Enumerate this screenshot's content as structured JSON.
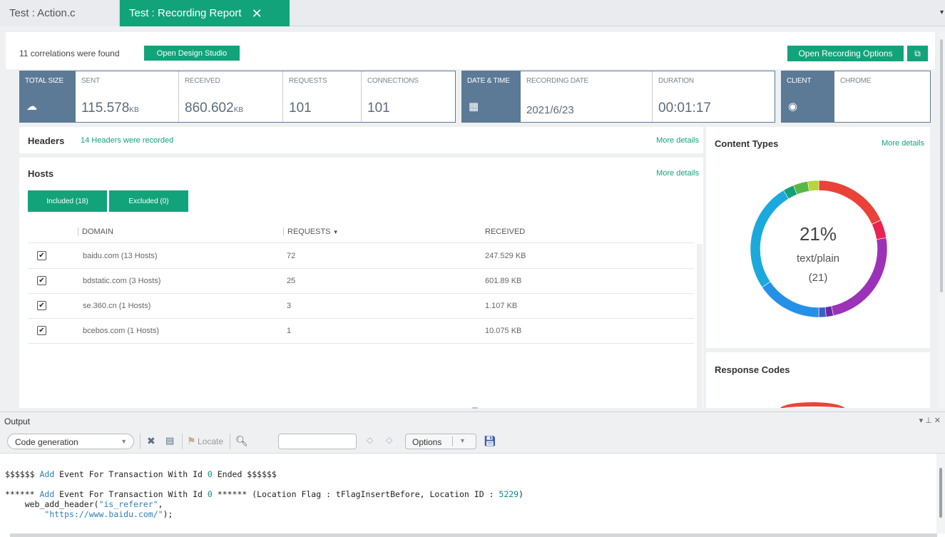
{
  "tabs": [
    {
      "label": "Test : Action.c"
    },
    {
      "label": "Test : Recording Report",
      "close": "✕"
    }
  ],
  "tab_menu_glyph": "▾",
  "top": {
    "correlations_text": "11 correlations were found",
    "design_studio_label": "Open Design Studio",
    "recording_options_label": "Open Recording Options",
    "external_link_glyph": "⧉"
  },
  "stats": {
    "total_size": {
      "label": "TOTAL SIZE",
      "icon": "cloud-upload-icon",
      "glyph": "☁"
    },
    "sent": {
      "label": "SENT",
      "value": "115.578",
      "unit": "KB"
    },
    "received": {
      "label": "RECEIVED",
      "value": "860.602",
      "unit": "KB"
    },
    "requests": {
      "label": "REQUESTS",
      "value": "101"
    },
    "connections": {
      "label": "CONNECTIONS",
      "value": "101"
    },
    "date_time": {
      "label": "DATE & TIME",
      "icon": "calendar-clock-icon",
      "glyph": "▦"
    },
    "recording_date": {
      "label": "RECORDING DATE",
      "value": "2021/6/23"
    },
    "duration": {
      "label": "DURATION",
      "value": "00:01:17"
    },
    "client": {
      "label": "CLIENT",
      "icon": "chrome-icon",
      "glyph": "◉"
    },
    "client_name": {
      "label": "CHROME"
    }
  },
  "headers_panel": {
    "title": "Headers",
    "subtitle": "14 Headers were recorded",
    "more": "More details"
  },
  "hosts_panel": {
    "title": "Hosts",
    "more": "More details",
    "included_label": "Included (18)",
    "excluded_label": "Excluded (0)",
    "columns": {
      "domain": "DOMAIN",
      "requests": "REQUESTS",
      "sort_glyph": "▼",
      "received": "RECEIVED"
    },
    "rows": [
      {
        "checked": "✔",
        "domain": "baidu.com (13 Hosts)",
        "requests": "72",
        "received": "247.529 KB"
      },
      {
        "checked": "✔",
        "domain": "bdstatic.com (3 Hosts)",
        "requests": "25",
        "received": "601.89 KB"
      },
      {
        "checked": "✔",
        "domain": "se.360.cn (1 Hosts)",
        "requests": "3",
        "received": "1.107 KB"
      },
      {
        "checked": "✔",
        "domain": "bcebos.com (1 Hosts)",
        "requests": "1",
        "received": "10.075 KB"
      }
    ]
  },
  "content_types": {
    "title": "Content Types",
    "more": "More details",
    "center_percent": "21%",
    "center_label": "text/plain",
    "center_count": "(21)"
  },
  "chart_data": {
    "type": "pie",
    "title": "Content Types",
    "labels": [
      "",
      "",
      "",
      "",
      "",
      "",
      "",
      "",
      "",
      ""
    ],
    "values": [
      21,
      5,
      28,
      2,
      2,
      18,
      30,
      3,
      4,
      3
    ],
    "colors": [
      "#ea4139",
      "#e8234f",
      "#9b32b8",
      "#6a2aa6",
      "#3d5fc4",
      "#2590e8",
      "#1aa9dc",
      "#14a07a",
      "#58b845",
      "#b7d43b"
    ]
  },
  "response_codes": {
    "title": "Response Codes"
  },
  "output": {
    "title": "Output",
    "pin_glyphs": "▾ ⊥ ✕",
    "combo_value": "Code generation",
    "locate_label": "Locate",
    "options_label": "Options",
    "code_lines": [
      {
        "segments": [
          {
            "t": "$$$$$$ ",
            "c": ""
          },
          {
            "t": "Add",
            "c": "kw"
          },
          {
            "t": " Event For Transaction With Id ",
            "c": ""
          },
          {
            "t": "0",
            "c": "num"
          },
          {
            "t": " Ended $$$$$$",
            "c": ""
          }
        ]
      },
      {
        "segments": [
          {
            "t": "",
            "c": ""
          }
        ]
      },
      {
        "segments": [
          {
            "t": "****** ",
            "c": ""
          },
          {
            "t": "Add",
            "c": "kw"
          },
          {
            "t": " Event For Transaction With Id ",
            "c": ""
          },
          {
            "t": "0",
            "c": "num"
          },
          {
            "t": " ****** (Location Flag : tFlagInsertBefore, Location ID : ",
            "c": ""
          },
          {
            "t": "5229",
            "c": "num"
          },
          {
            "t": ")",
            "c": ""
          }
        ]
      },
      {
        "segments": [
          {
            "t": "    web_add_header(",
            "c": ""
          },
          {
            "t": "\"is_referer\"",
            "c": "str"
          },
          {
            "t": ",",
            "c": ""
          }
        ]
      },
      {
        "segments": [
          {
            "t": "        ",
            "c": ""
          },
          {
            "t": "\"https://www.baidu.com/\"",
            "c": "str"
          },
          {
            "t": ");",
            "c": ""
          }
        ]
      }
    ]
  }
}
